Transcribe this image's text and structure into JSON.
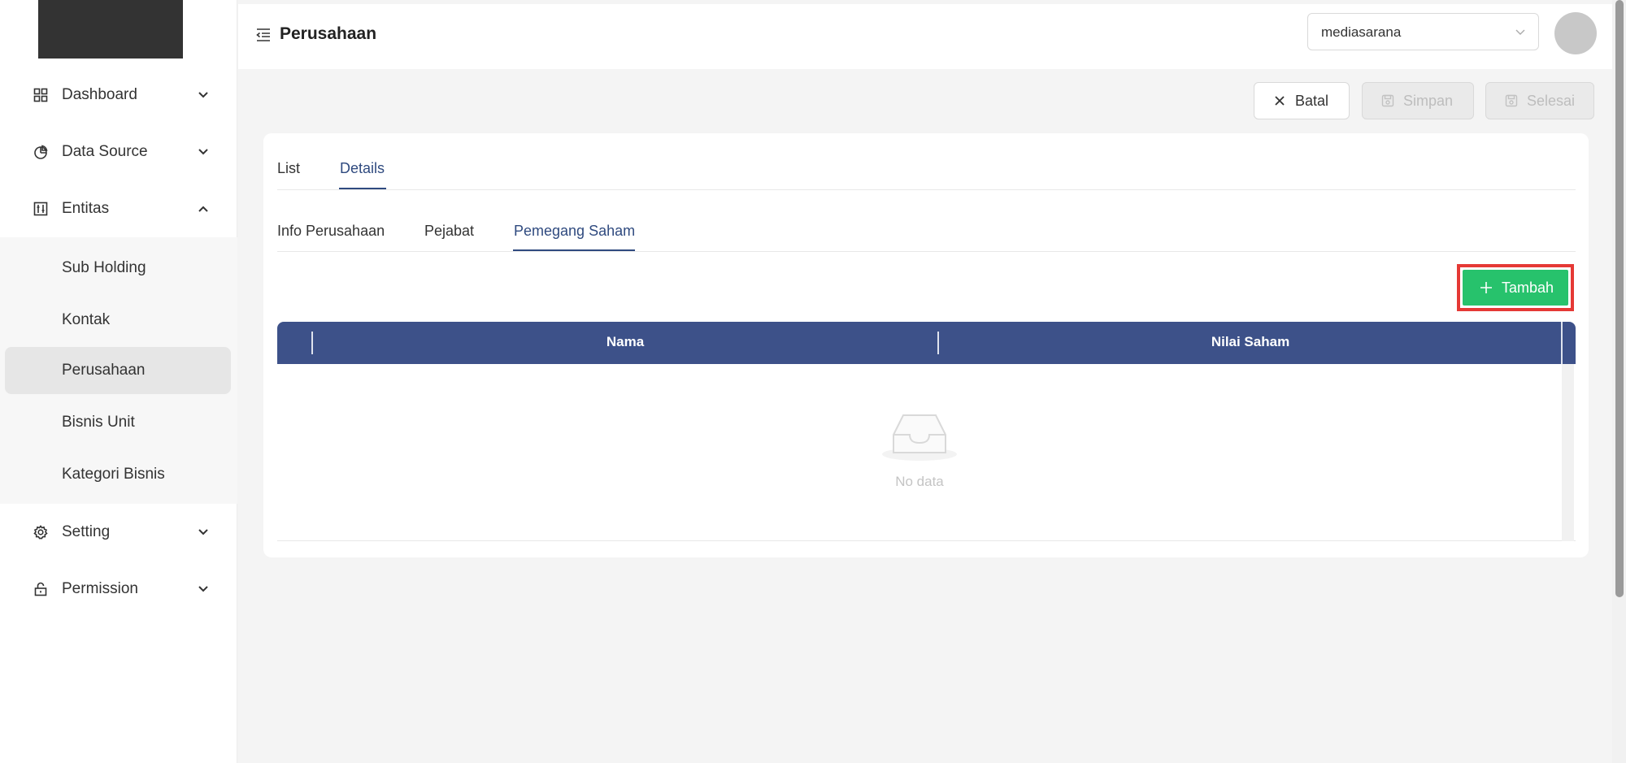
{
  "sidebar": {
    "items": [
      {
        "label": "Dashboard",
        "icon": "dashboard-icon",
        "expanded": false
      },
      {
        "label": "Data Source",
        "icon": "pie-chart-icon",
        "expanded": false
      },
      {
        "label": "Entitas",
        "icon": "control-panel-icon",
        "expanded": true
      },
      {
        "label": "Setting",
        "icon": "gear-icon",
        "expanded": false
      },
      {
        "label": "Permission",
        "icon": "lock-icon",
        "expanded": false
      }
    ],
    "entitas_sub": [
      {
        "label": "Sub Holding"
      },
      {
        "label": "Kontak"
      },
      {
        "label": "Perusahaan",
        "active": true
      },
      {
        "label": "Bisnis Unit"
      },
      {
        "label": "Kategori Bisnis"
      }
    ]
  },
  "header": {
    "title": "Perusahaan",
    "org_select": {
      "value": "mediasarana"
    }
  },
  "actions": {
    "batal": "Batal",
    "simpan": "Simpan",
    "selesai": "Selesai"
  },
  "tabs": {
    "main": [
      {
        "label": "List"
      },
      {
        "label": "Details",
        "active": true
      }
    ],
    "detail": [
      {
        "label": "Info Perusahaan"
      },
      {
        "label": "Pejabat"
      },
      {
        "label": "Pemegang Saham",
        "active": true
      }
    ]
  },
  "table": {
    "add_label": "Tambah",
    "columns": [
      "Nama",
      "Nilai Saham"
    ],
    "rows": [],
    "empty_text": "No data"
  },
  "colors": {
    "primary": "#3d5189",
    "success": "#27c26c",
    "highlight": "#e53935"
  }
}
